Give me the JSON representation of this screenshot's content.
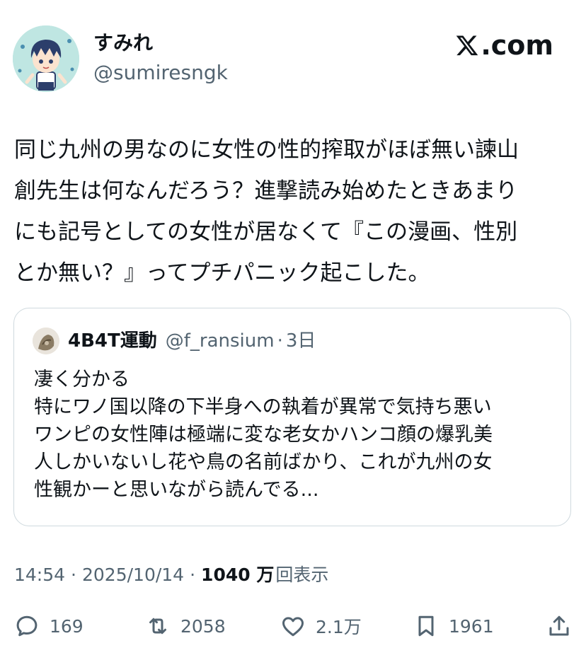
{
  "author": {
    "name": "すみれ",
    "handle": "@sumiresngk"
  },
  "brand": {
    "label": ".com",
    "icon": "x-logo-icon"
  },
  "tweet": {
    "lines": [
      "同じ九州の男なのに女性の性的搾取がほぼ無い諫山",
      "創先生は何なんだろう？進撃読み始めたときあまり",
      "にも記号としての女性が居なくて『この漫画、性別",
      "とか無い？』ってプチパニック起こした。"
    ]
  },
  "quote": {
    "name": "4B4T運動",
    "handle": "@f_ransium",
    "dot": "·",
    "time": "3日",
    "lines": [
      "凄く分かる",
      "特にワノ国以降の下半身への執着が異常で気持ち悪い",
      "ワンピの女性陣は極端に変な老女かハンコ顔の爆乳美",
      "人しかいないし花や鳥の名前ばかり、これが九州の女",
      "性観かーと思いながら読んでる..."
    ]
  },
  "meta": {
    "time": "14:54",
    "sep1": "·",
    "date": "2025/10/14",
    "sep2": "·",
    "views_count": "1040",
    "views_unit": "万",
    "views_label": "回表示"
  },
  "actions": {
    "replies": "169",
    "retweets": "2058",
    "likes": "2.1万",
    "bookmarks": "1961",
    "icons": [
      "reply-icon",
      "retweet-icon",
      "like-icon",
      "bookmark-icon",
      "share-icon"
    ]
  },
  "colors": {
    "text": "#0f1419",
    "secondary": "#536471",
    "border": "#cfd9de",
    "avatar_bg": "#bfe6e2"
  }
}
